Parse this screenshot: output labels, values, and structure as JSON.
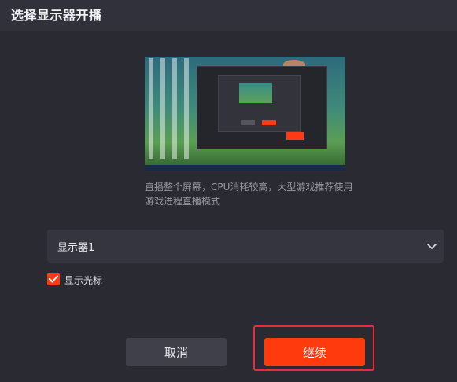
{
  "dialog": {
    "title": "选择显示器开播",
    "description": "直播整个屏幕，CPU消耗较高，大型游戏推荐使用游戏进程直播模式"
  },
  "monitor_select": {
    "selected": "显示器1",
    "icon": "chevron-down-icon"
  },
  "show_cursor": {
    "label": "显示光标",
    "checked": true,
    "icon": "checkmark-icon"
  },
  "buttons": {
    "cancel_label": "取消",
    "continue_label": "继续"
  },
  "colors": {
    "accent": "#ff3a0d",
    "highlight_border": "#ec2a3a",
    "background": "#2a2a33",
    "panel": "#35353f"
  }
}
